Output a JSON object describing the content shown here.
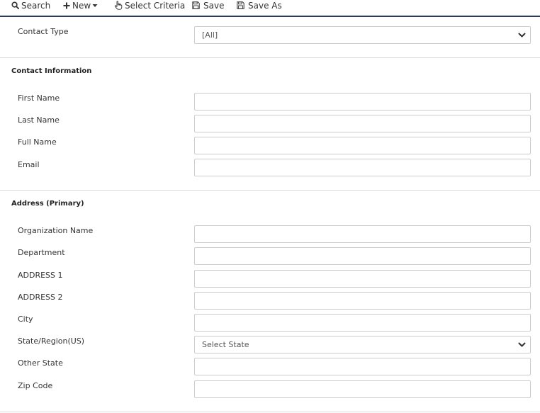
{
  "toolbar": {
    "search_label": "Search",
    "new_label": "New",
    "select_criteria_label": "Select Criteria",
    "save_label": "Save",
    "save_as_label": "Save As"
  },
  "contact_type": {
    "label": "Contact Type",
    "selected": "[All]"
  },
  "contact_information": {
    "title": "Contact Information",
    "fields": {
      "first_name": "First Name",
      "last_name": "Last Name",
      "full_name": "Full Name",
      "email": "Email"
    }
  },
  "address": {
    "title": "Address (Primary)",
    "fields": {
      "organization_name": "Organization Name",
      "department": "Department",
      "address1": "ADDRESS 1",
      "address2": "ADDRESS 2",
      "city": "City",
      "state_region": "State/Region(US)",
      "other_state": "Other State",
      "zip_code": "Zip Code"
    },
    "state_selected": "Select State"
  },
  "colors": {
    "toolbar_rule": "#2d3e50",
    "divider": "#d9d9d9",
    "input_border": "#cccccc",
    "text": "#333333"
  },
  "icons": {
    "search": "search-icon",
    "new": "plus-icon",
    "new_caret": "caret-down-icon",
    "select_criteria": "hand-pointer-icon",
    "save": "floppy-disk-icon",
    "save_as": "floppy-disk-icon",
    "select_chevron": "chevron-down-icon"
  }
}
